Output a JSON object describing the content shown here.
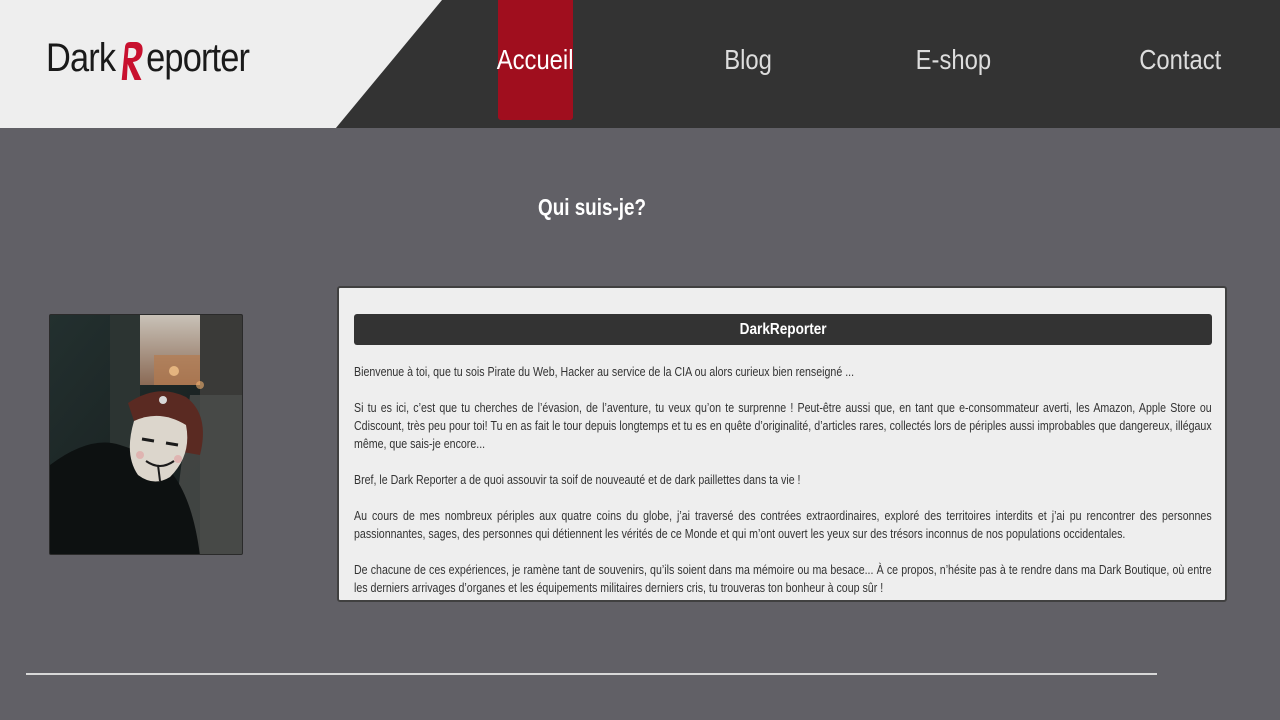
{
  "header": {
    "logo": {
      "prefix": "Dark",
      "mark": "R",
      "suffix": "eporter"
    },
    "nav": [
      {
        "label": "Accueil",
        "active": true
      },
      {
        "label": "Blog",
        "active": false
      },
      {
        "label": "E-shop",
        "active": false
      },
      {
        "label": "Contact",
        "active": false
      }
    ]
  },
  "main": {
    "section_title": "Qui suis-je?",
    "card": {
      "title": "DarkReporter",
      "paragraphs": [
        "Bienvenue à toi, que tu sois Pirate du Web, Hacker au service de la CIA ou alors curieux bien renseigné ...",
        "Si tu es ici, c’est que tu cherches de l’évasion, de l’aventure, tu veux qu’on te surprenne ! Peut-être aussi que, en tant que e-consommateur averti, les Amazon, Apple Store ou Cdiscount, très peu pour toi! Tu en as fait le tour depuis longtemps et tu es en quête d’originalité, d’articles rares, collectés lors de périples aussi improbables que dangereux, illégaux même, que sais-je encore...",
        "Bref, le Dark Reporter a de quoi assouvir ta soif de nouveauté et de dark paillettes dans ta vie !",
        "Au cours de mes nombreux périples aux quatre coins du globe, j’ai traversé des contrées extraordinaires, exploré des territoires interdits et j’ai pu rencontrer des personnes passionnantes, sages, des personnes qui détiennent les vérités de ce Monde et qui m’ont ouvert les yeux sur des trésors inconnus de nos populations occidentales.",
        "De chacune de ces expériences, je ramène tant de souvenirs, qu’ils soient dans ma mémoire ou ma besace... À ce propos, n’hésite pas à te rendre dans ma Dark Boutique, où entre les derniers arrivages d’organes et les équipements militaires derniers cris, tu trouveras ton bonheur à coup sûr !"
      ]
    }
  },
  "colors": {
    "background": "#616066",
    "header": "#333333",
    "accent": "#a00e1e",
    "card": "#eeeeee"
  }
}
